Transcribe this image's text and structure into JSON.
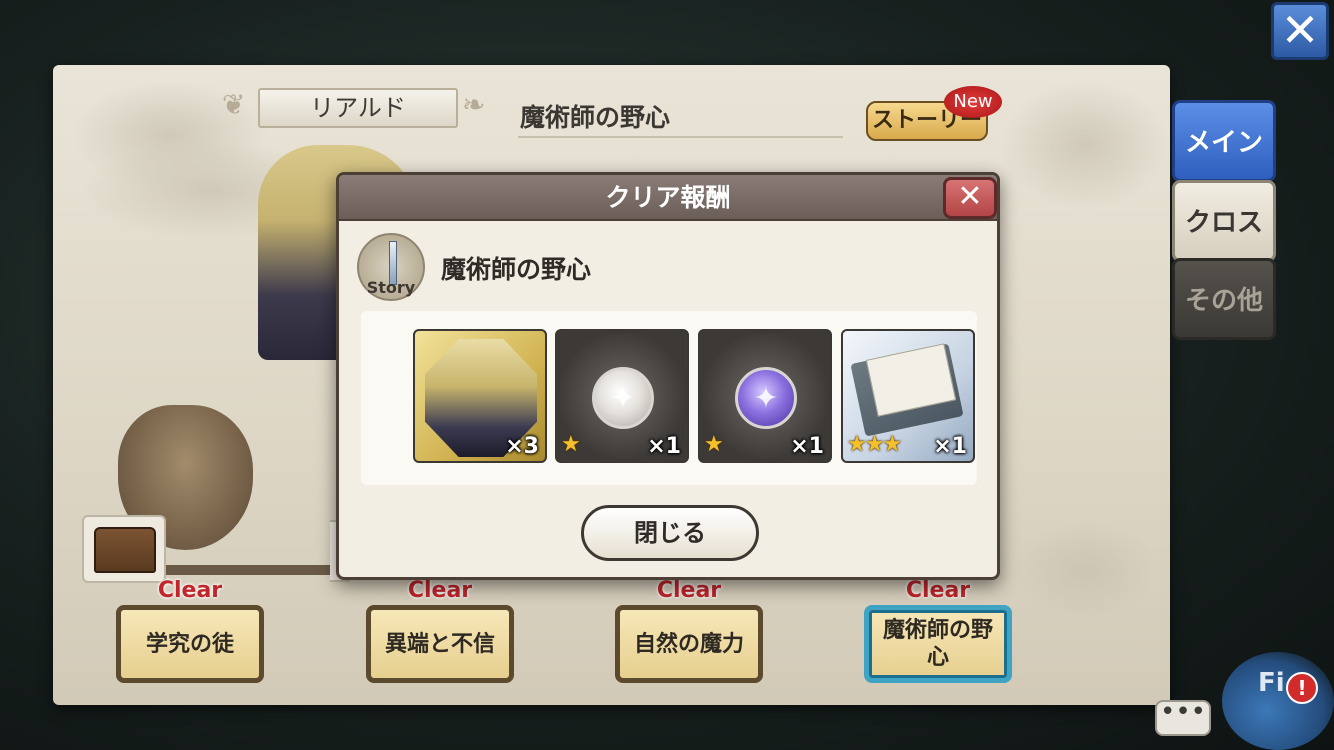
{
  "header": {
    "stage_name": "リアルド",
    "chapter_title": "魔術師の野心",
    "story_button_label": "ストーリー",
    "new_badge": "New"
  },
  "side_tabs": [
    {
      "label": "メイン",
      "active": true
    },
    {
      "label": "クロス",
      "active": false
    },
    {
      "label": "その他",
      "active": false
    }
  ],
  "stages": [
    {
      "status": "Clear",
      "label": "学究の徒"
    },
    {
      "status": "Clear",
      "label": "異端と不信"
    },
    {
      "status": "Clear",
      "label": "自然の魔力"
    },
    {
      "status": "Clear",
      "label": "魔術師の野心",
      "selected": true
    }
  ],
  "dialog": {
    "title": "クリア報酬",
    "close_glyph": "✕",
    "badge_text": "Story",
    "chapter_title": "魔術師の野心",
    "rewards": [
      {
        "icon": "character-portrait",
        "stars": "",
        "quantity": "×3"
      },
      {
        "icon": "white-orb",
        "stars": "★",
        "quantity": "×1"
      },
      {
        "icon": "purple-orb",
        "stars": "★",
        "quantity": "×1"
      },
      {
        "icon": "tome",
        "stars": "★★★",
        "quantity": "×1"
      }
    ],
    "close_button_label": "閉じる"
  },
  "hud": {
    "close_glyph": "✕",
    "chat_glyph": "•••",
    "field_label": "Fi",
    "alert_glyph": "!"
  },
  "colors": {
    "accent_blue": "#2f5fbf",
    "clear_red": "#c0262b",
    "stage_selected": "#3fa3c3"
  }
}
